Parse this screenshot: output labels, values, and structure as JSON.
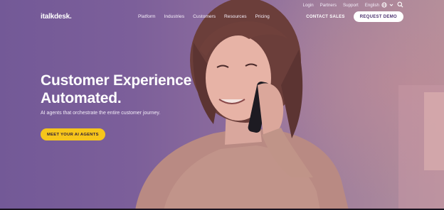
{
  "brand": {
    "logo_text": "talkdesk",
    "logo_prefix": "i",
    "logo_suffix": "."
  },
  "utility_nav": {
    "login": "Login",
    "partners": "Partners",
    "support": "Support",
    "language": "English"
  },
  "main_nav": {
    "items": [
      "Platform",
      "Industries",
      "Customers",
      "Resources",
      "Pricing"
    ],
    "contact_sales": "CONTACT SALES",
    "request_demo": "REQUEST DEMO"
  },
  "hero": {
    "headline_line1": "Customer Experience",
    "headline_line2": "Automated.",
    "subhead": "AI agents that orchestrate the entire customer journey.",
    "cta_label": "MEET YOUR AI AGENTS"
  },
  "colors": {
    "overlay_purple": "#7a5e9a",
    "cta_yellow": "#f6c51b",
    "demo_text": "#4a2f6e"
  },
  "icons": [
    "globe-icon",
    "chevron-down-icon",
    "search-icon"
  ]
}
